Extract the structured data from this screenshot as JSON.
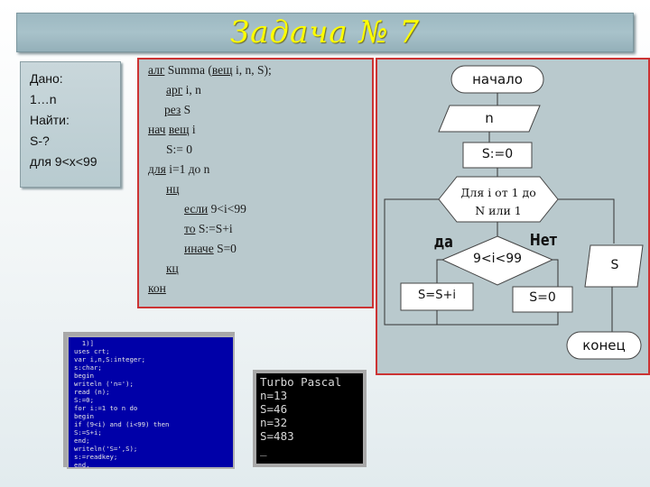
{
  "title": "Задача № 7",
  "given": {
    "lines": [
      "Дано:",
      "1…n",
      "Найти:",
      "S-?",
      "для 9<x<99"
    ]
  },
  "algorithm": {
    "l1_kw": "алг",
    "l1_rest": " Summa (",
    "l1_kw2": "вещ",
    "l1_rest2": " i, n, S);",
    "l2_kw": "арг",
    "l2_rest": " i, n",
    "l3_kw": "рез",
    "l3_rest": " S",
    "l4_kw": "нач",
    "l4_mid": " ",
    "l4_kw2": "вещ",
    "l4_rest": " i",
    "l5": "S:= 0",
    "l6_kw": "для",
    "l6_rest": " i=1 до n",
    "l7_kw": "нц",
    "l8_kw": "если",
    "l8_rest": " 9<i<99",
    "l9_kw": "то",
    "l9_rest": " S:=S+i",
    "l10_kw": "иначе",
    "l10_rest": " S=0",
    "l11_kw": "кц",
    "l12_kw": "кон"
  },
  "flowchart": {
    "start": "начало",
    "input": "n",
    "init": "S:=0",
    "loop_line1": "Для i от 1 до",
    "loop_line2": "N или 1",
    "yes": "да",
    "no": "Нет",
    "condition": "9<i<99",
    "yes_action": "S=S+i",
    "no_action": "S=0",
    "output": "S",
    "end": "конец"
  },
  "code_window": {
    "lines": [
      "  1)]",
      "uses crt;",
      "var i,n,S:integer;",
      "s:char;",
      "begin",
      "writeln ('n=');",
      "read (n);",
      "S:=0;",
      "for i:=1 to n do",
      "begin",
      "if (9<i) and (i<99) then",
      "S:=S+i;",
      "end;",
      "writeln('S=',S);",
      "s:=readkey;",
      "end."
    ]
  },
  "output_window": {
    "lines": [
      "Turbo Pascal",
      "n=13",
      "S=46",
      "n=32",
      "S=483",
      "_"
    ]
  }
}
